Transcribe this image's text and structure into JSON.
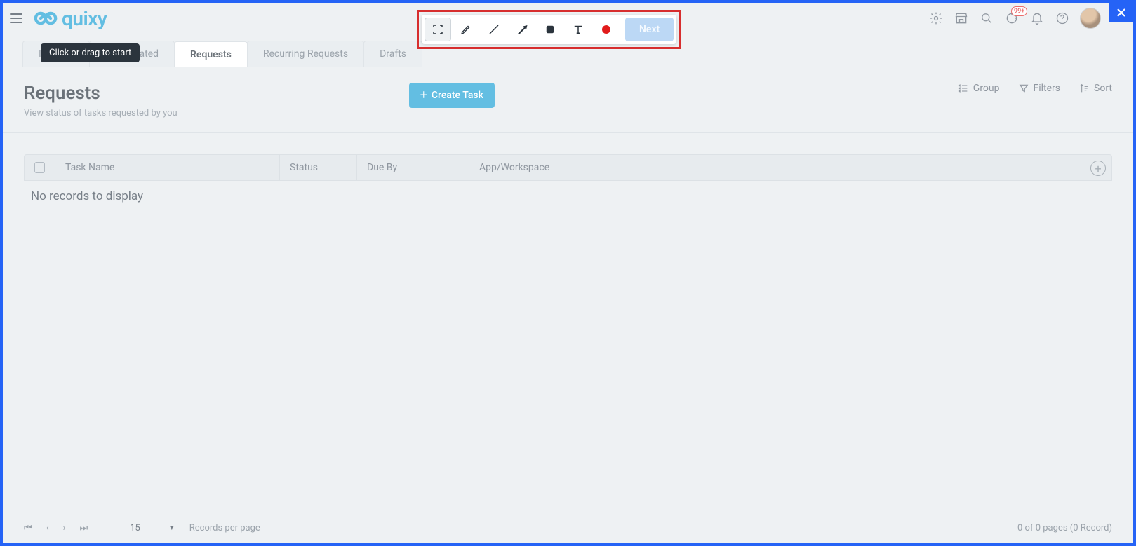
{
  "brand": {
    "name": "quixy"
  },
  "cornerClose": "×",
  "headerIcons": {
    "badge99": "99+"
  },
  "tooltip": "Click or drag to start",
  "annotation": {
    "next": "Next"
  },
  "tabs": [
    {
      "label": "Initiated",
      "active": false
    },
    {
      "label": "Participated",
      "active": false
    },
    {
      "label": "Requests",
      "active": true
    },
    {
      "label": "Recurring Requests",
      "active": false
    },
    {
      "label": "Drafts",
      "active": false
    }
  ],
  "page": {
    "title": "Requests",
    "subtitle": "View status of tasks requested by you",
    "createBtn": "Create Task"
  },
  "viewTools": {
    "group": "Group",
    "filters": "Filters",
    "sort": "Sort"
  },
  "table": {
    "columns": {
      "name": "Task Name",
      "status": "Status",
      "due": "Due By",
      "app": "App/Workspace"
    },
    "empty": "No records to display",
    "rows": []
  },
  "pager": {
    "pageSize": "15",
    "pageSizeLabel": "Records per page",
    "info": "0 of 0 pages (0 Record)"
  }
}
